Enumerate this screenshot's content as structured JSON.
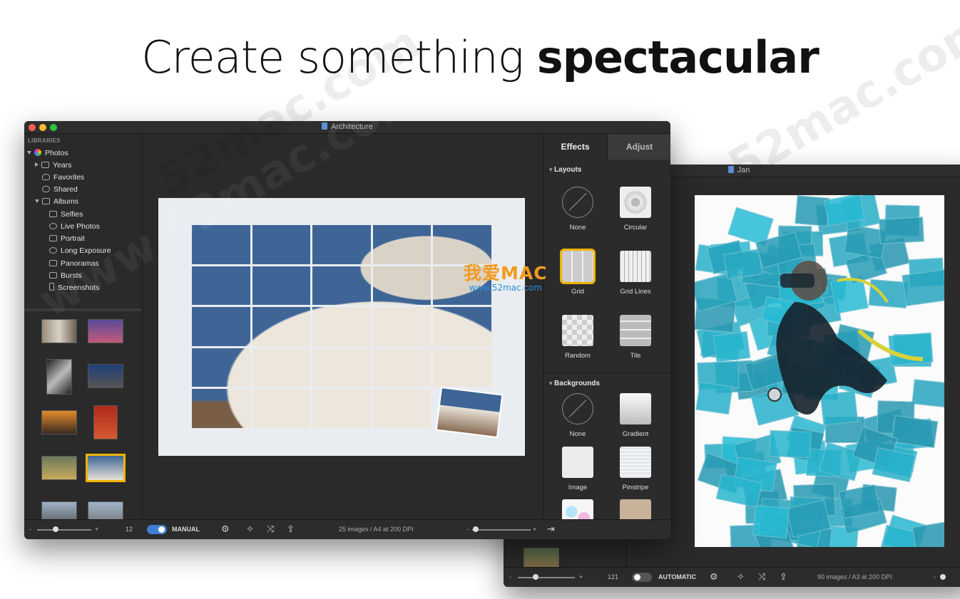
{
  "headline": {
    "light": "Create something ",
    "bold": "spectacular"
  },
  "watermarks": [
    "52mac.com",
    "www.52mac.com"
  ],
  "watermark_logo": {
    "text": "我爱MAC",
    "url": "www.52mac.com"
  },
  "window1": {
    "title": "Architecture",
    "sidebar": {
      "section": "LIBRARIES",
      "items": [
        {
          "label": "Photos"
        },
        {
          "label": "Years"
        },
        {
          "label": "Favorites"
        },
        {
          "label": "Shared"
        },
        {
          "label": "Albums"
        },
        {
          "label": "Selfies"
        },
        {
          "label": "Live Photos"
        },
        {
          "label": "Portrait"
        },
        {
          "label": "Long Exposure"
        },
        {
          "label": "Panoramas"
        },
        {
          "label": "Bursts"
        },
        {
          "label": "Screenshots"
        }
      ]
    },
    "bottom": {
      "minus": "-",
      "plus": "+",
      "count": "12",
      "mode": "MANUAL",
      "status": "25 images / A4 at 200 DPI"
    },
    "panel": {
      "tabs": [
        "Effects",
        "Adjust"
      ],
      "layouts_title": "Layouts",
      "layouts": [
        "None",
        "Circular",
        "Grid",
        "Grid Lines",
        "Random",
        "Tile"
      ],
      "backgrounds_title": "Backgrounds",
      "backgrounds": [
        "None",
        "Gradient",
        "Image",
        "Pinstripe"
      ]
    }
  },
  "window2": {
    "title": "Jan",
    "bottom": {
      "minus": "-",
      "plus": "+",
      "count": "121",
      "mode": "AUTOMATIC",
      "status": "90 images / A3 at 200 DPI"
    }
  },
  "colors": {
    "accent": "#f0b400",
    "toggle_on": "#3f7fd6",
    "sky": "#3e6596",
    "water": "#3aa0b5"
  }
}
